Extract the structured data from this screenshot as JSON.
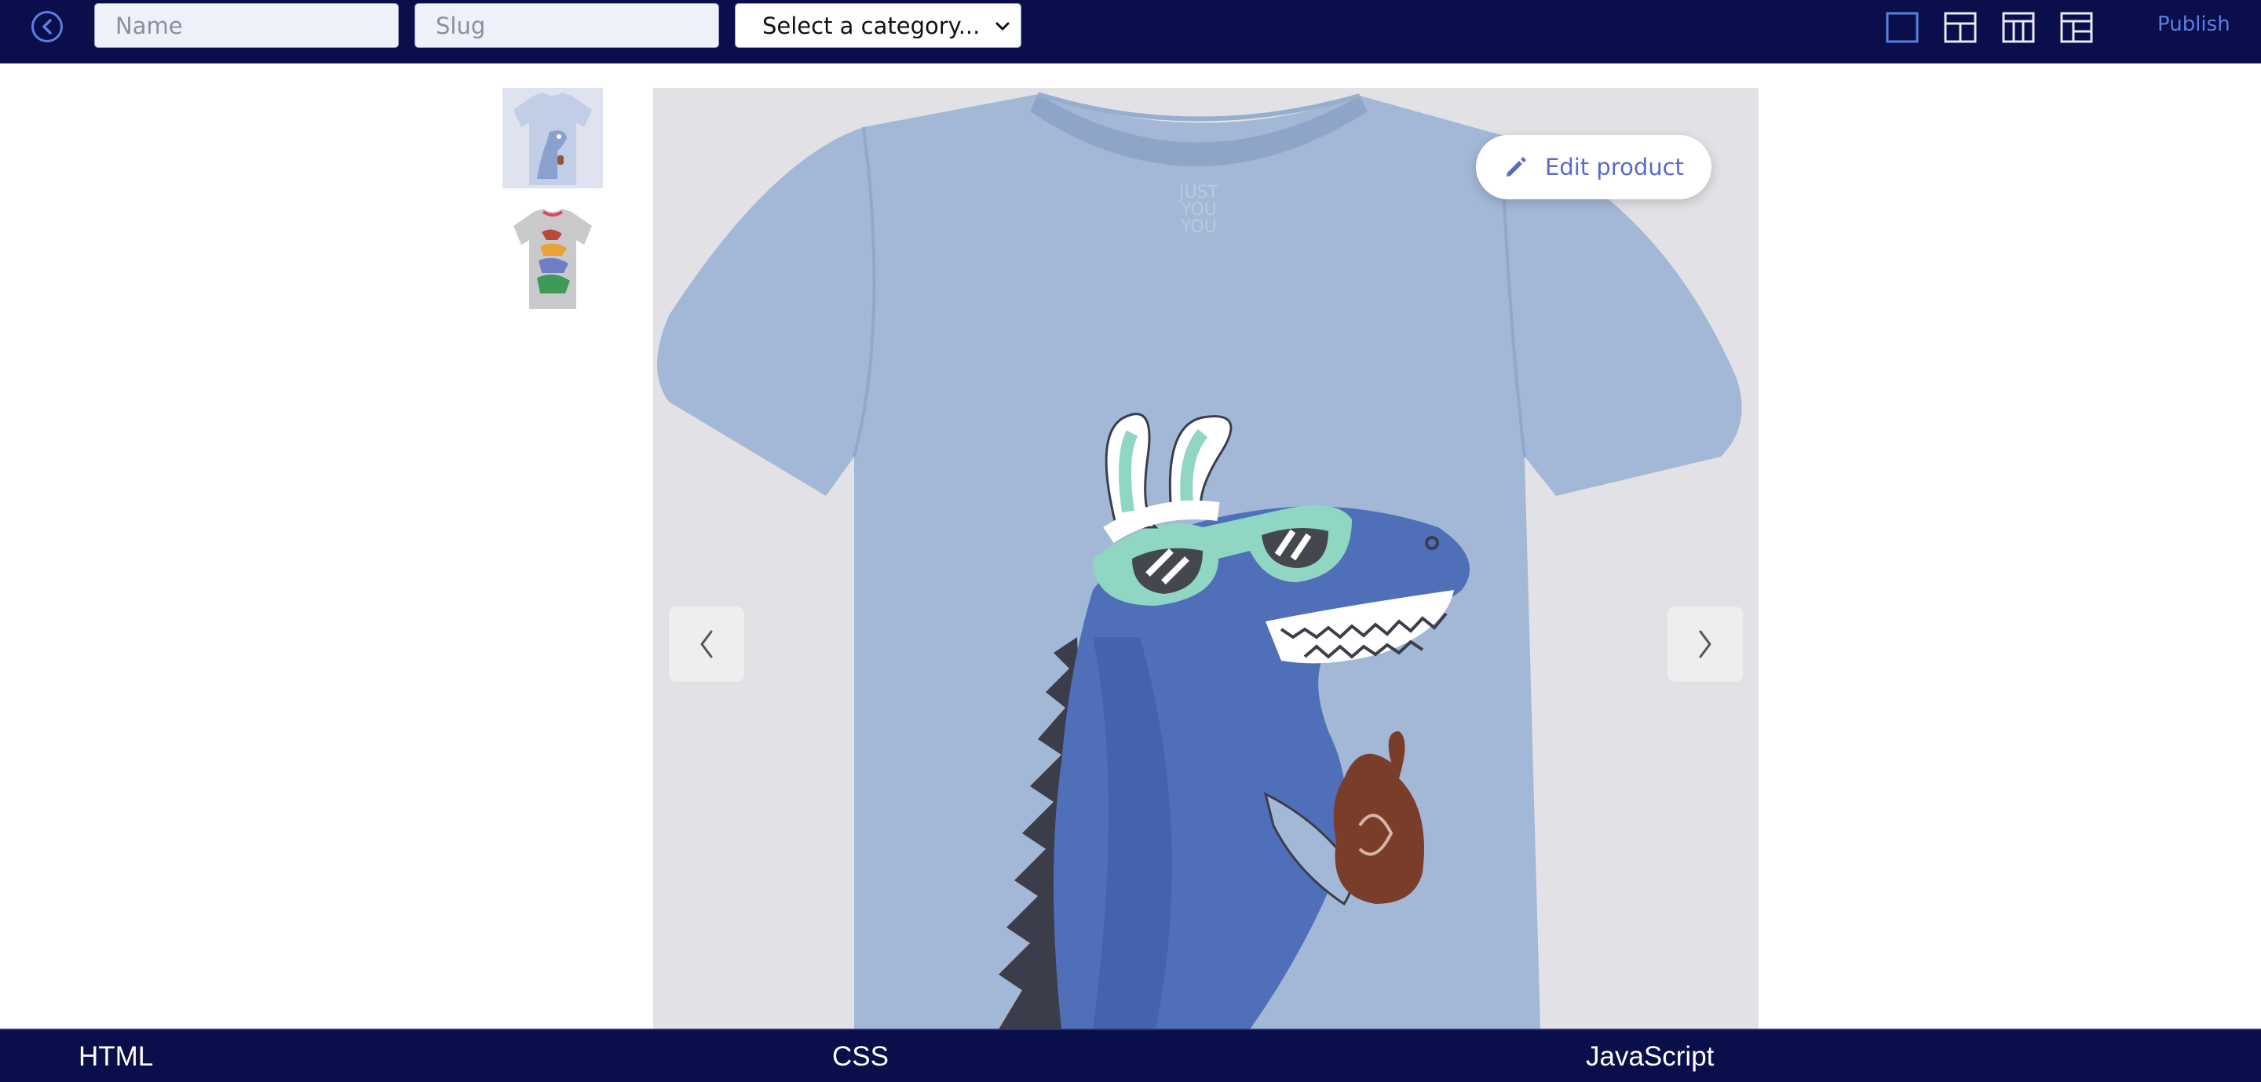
{
  "topbar": {
    "name_placeholder": "Name",
    "slug_placeholder": "Slug",
    "category_select": "Select a category...",
    "publish_label": "Publish",
    "layout_options": [
      "single-column-layout-icon",
      "header-split-layout-icon",
      "three-column-layout-icon",
      "sidebar-layout-icon"
    ],
    "selected_layout_index": 0
  },
  "gallery": {
    "thumbnails": [
      "t-shirt-dino-blue",
      "t-shirt-dino-gray"
    ],
    "edit_label": "Edit product"
  },
  "bottombar": {
    "tabs": [
      "HTML",
      "CSS",
      "JavaScript"
    ]
  },
  "colors": {
    "bar_bg": "#0a0e4a",
    "accent": "#5b7fe0",
    "shirt_blue": "#a3b8d6",
    "shirt_gray": "#c9c9cb"
  }
}
